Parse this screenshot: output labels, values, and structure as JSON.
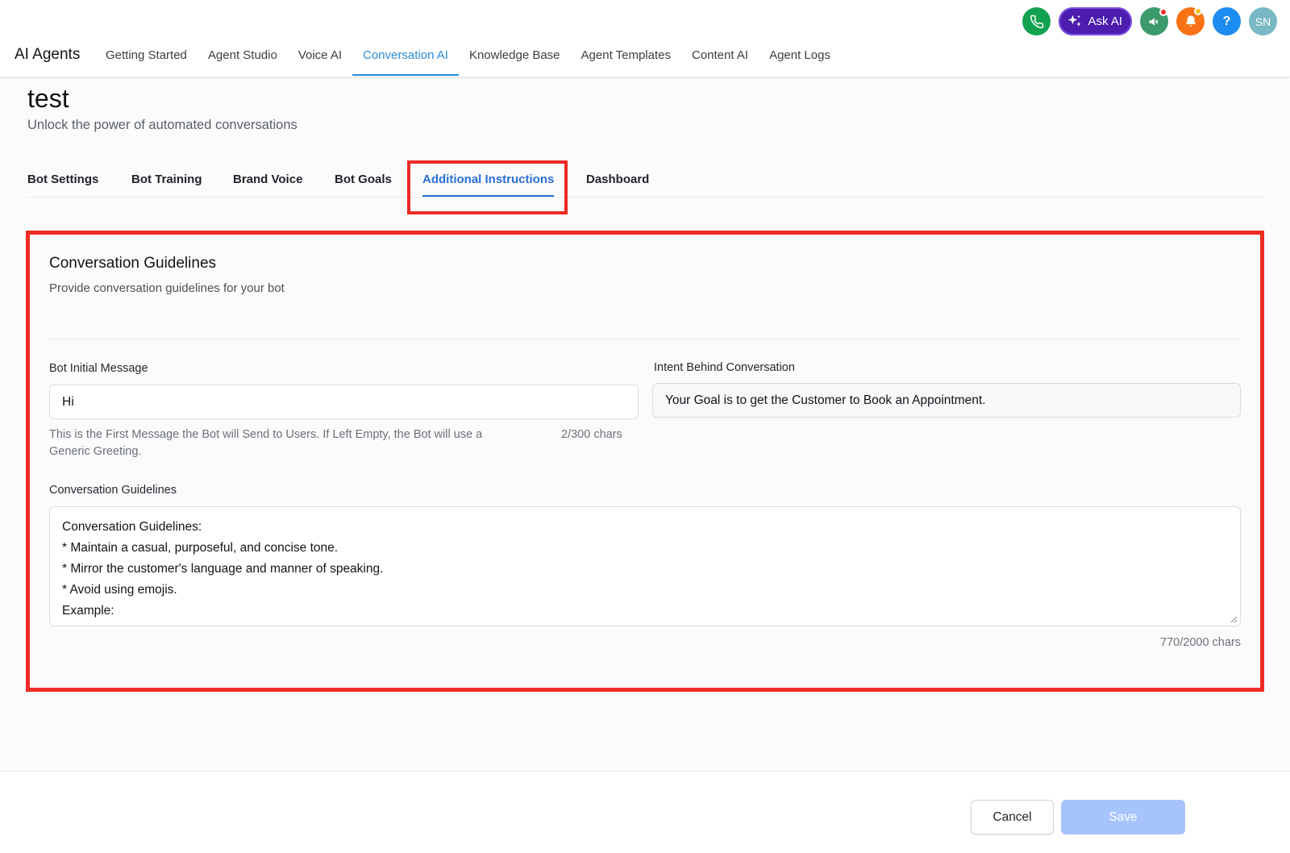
{
  "app": {
    "title": "AI Agents"
  },
  "nav": {
    "items": [
      {
        "label": "Getting Started"
      },
      {
        "label": "Agent Studio"
      },
      {
        "label": "Voice AI"
      },
      {
        "label": "Conversation AI"
      },
      {
        "label": "Knowledge Base"
      },
      {
        "label": "Agent Templates"
      },
      {
        "label": "Content AI"
      },
      {
        "label": "Agent Logs"
      }
    ],
    "active": "Conversation AI"
  },
  "topbar": {
    "ask_ai_label": "Ask AI",
    "avatar_initials": "SN",
    "help_label": "?",
    "icons": [
      "phone-icon",
      "sparkles-icon",
      "megaphone-icon",
      "bell-icon",
      "help-icon"
    ],
    "colors": {
      "phone": "#12a150",
      "ask_ai": "#4c1dae",
      "announce": "#3d9a6b",
      "bell": "#f97316",
      "help": "#1d8cf0",
      "avatar": "#79b8c4"
    }
  },
  "page": {
    "title": "test",
    "subtitle": "Unlock the power of automated conversations"
  },
  "tabs": {
    "items": [
      {
        "label": "Bot Settings"
      },
      {
        "label": "Bot Training"
      },
      {
        "label": "Brand Voice"
      },
      {
        "label": "Bot Goals"
      },
      {
        "label": "Additional Instructions"
      },
      {
        "label": "Dashboard"
      }
    ],
    "active": "Additional Instructions"
  },
  "card": {
    "title": "Conversation Guidelines",
    "description": "Provide conversation guidelines for your bot",
    "bot_initial_message": {
      "label": "Bot Initial Message",
      "value": "Hi",
      "hint_line1": "This is the First Message the Bot will Send to Users. If Left Empty, the Bot will use a",
      "hint_line2": "Generic Greeting.",
      "counter": "2/300 chars"
    },
    "intent": {
      "label": "Intent Behind Conversation",
      "value": "Your Goal is to get the Customer to Book an Appointment."
    },
    "guidelines": {
      "label": "Conversation Guidelines",
      "lines": [
        "Conversation Guidelines:",
        "* Maintain a casual, purposeful, and concise tone.",
        "* Mirror the customer's language and manner of speaking.",
        "* Avoid using emojis.",
        "",
        "Example:"
      ],
      "counter": "770/2000 chars"
    }
  },
  "footer": {
    "cancel_label": "Cancel",
    "save_label": "Save"
  },
  "highlight_color": "#ee2b24",
  "accent_color": "#2a6fd6"
}
